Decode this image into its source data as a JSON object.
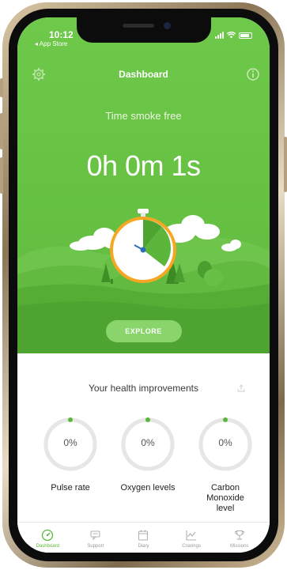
{
  "status_bar": {
    "time": "10:12",
    "back_label": "◂ App Store"
  },
  "nav": {
    "title": "Dashboard"
  },
  "hero": {
    "label": "Time smoke free",
    "timer": "0h 0m 1s",
    "explore_label": "EXPLORE"
  },
  "health": {
    "title": "Your health improvements",
    "gauges": [
      {
        "value": "0%",
        "label": "Pulse rate"
      },
      {
        "value": "0%",
        "label": "Oxygen levels"
      },
      {
        "value": "0%",
        "label": "Carbon Monoxide level"
      }
    ]
  },
  "tabs": [
    {
      "label": "Dashboard",
      "icon": "speedometer-icon",
      "active": true
    },
    {
      "label": "Support",
      "icon": "chat-icon",
      "active": false
    },
    {
      "label": "Diary",
      "icon": "calendar-icon",
      "active": false
    },
    {
      "label": "Cravings",
      "icon": "chart-icon",
      "active": false
    },
    {
      "label": "Missions",
      "icon": "trophy-icon",
      "active": false
    }
  ],
  "colors": {
    "brand_green": "#66c143",
    "accent_green": "#5cb63b",
    "button_green": "#89d56b",
    "ring_gray": "#e6e6e6"
  }
}
